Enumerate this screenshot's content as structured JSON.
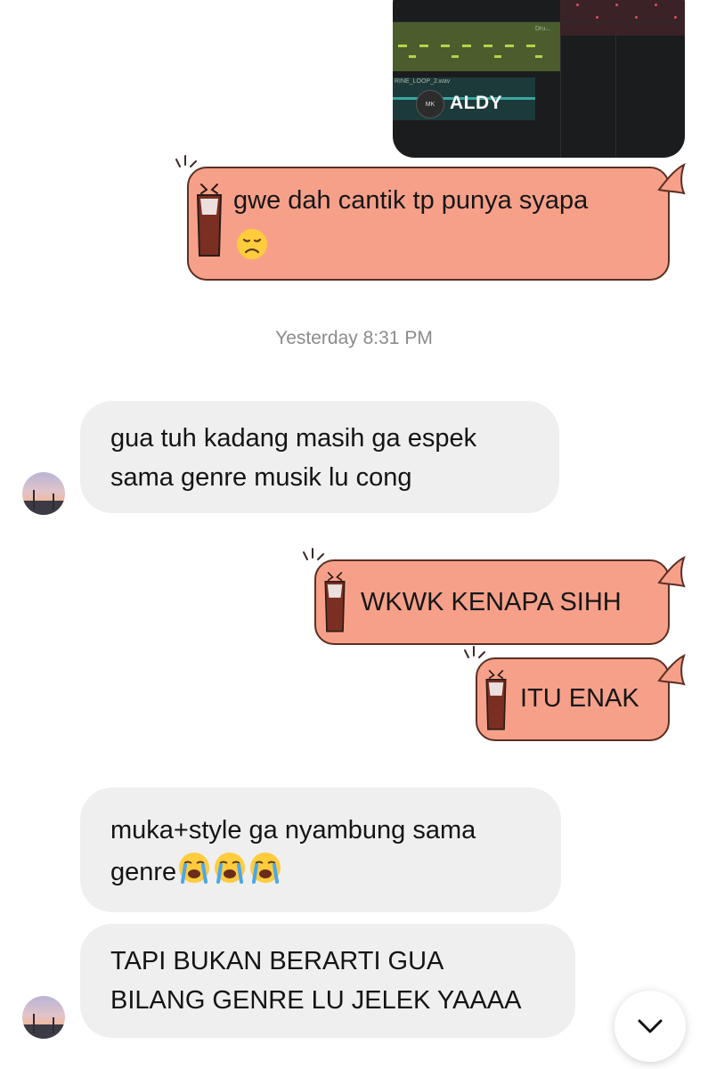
{
  "shared_media": {
    "name": "ALDY",
    "track_label": "Dru...",
    "file_label": "RINE_LOOP_2.wav"
  },
  "messages": {
    "out1": {
      "line1": "gwe dah cantik tp punya syapa",
      "emoji": "disappointed-face"
    },
    "timestamp": "Yesterday 8:31 PM",
    "in1": {
      "line1": "gua tuh kadang masih ga espek",
      "line2": "sama genre musik lu cong"
    },
    "out2": {
      "text": "WKWK KENAPA SIHH"
    },
    "out3": {
      "text": "ITU ENAK"
    },
    "in2": {
      "line1": "muka+style ga nyambung sama",
      "line2": "genre",
      "emoji": "loudly-crying-face x3"
    },
    "in3": {
      "line1": "TAPI BUKAN BERARTI GUA",
      "line2": "BILANG GENRE LU JELEK YAAAA"
    }
  },
  "colors": {
    "outgoing_bubble": "#f7a089",
    "incoming_bubble": "#efefef",
    "outline": "#5b3024"
  },
  "icons": {
    "scroll_down": "chevron-down-icon",
    "bubble_decoration": "crying-cup-sticker-icon"
  }
}
